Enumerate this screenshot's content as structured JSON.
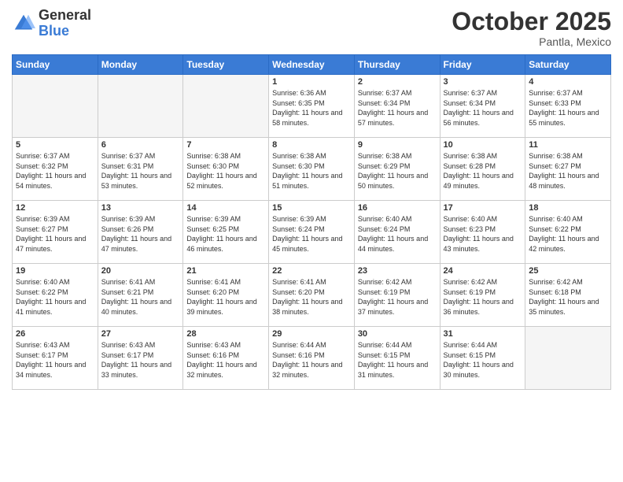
{
  "logo": {
    "general": "General",
    "blue": "Blue"
  },
  "header": {
    "month": "October 2025",
    "location": "Pantla, Mexico"
  },
  "weekdays": [
    "Sunday",
    "Monday",
    "Tuesday",
    "Wednesday",
    "Thursday",
    "Friday",
    "Saturday"
  ],
  "weeks": [
    [
      {
        "day": "",
        "empty": true
      },
      {
        "day": "",
        "empty": true
      },
      {
        "day": "",
        "empty": true
      },
      {
        "day": "1",
        "sunrise": "6:36 AM",
        "sunset": "6:35 PM",
        "daylight": "11 hours and 58 minutes."
      },
      {
        "day": "2",
        "sunrise": "6:37 AM",
        "sunset": "6:34 PM",
        "daylight": "11 hours and 57 minutes."
      },
      {
        "day": "3",
        "sunrise": "6:37 AM",
        "sunset": "6:34 PM",
        "daylight": "11 hours and 56 minutes."
      },
      {
        "day": "4",
        "sunrise": "6:37 AM",
        "sunset": "6:33 PM",
        "daylight": "11 hours and 55 minutes."
      }
    ],
    [
      {
        "day": "5",
        "sunrise": "6:37 AM",
        "sunset": "6:32 PM",
        "daylight": "11 hours and 54 minutes."
      },
      {
        "day": "6",
        "sunrise": "6:37 AM",
        "sunset": "6:31 PM",
        "daylight": "11 hours and 53 minutes."
      },
      {
        "day": "7",
        "sunrise": "6:38 AM",
        "sunset": "6:30 PM",
        "daylight": "11 hours and 52 minutes."
      },
      {
        "day": "8",
        "sunrise": "6:38 AM",
        "sunset": "6:30 PM",
        "daylight": "11 hours and 51 minutes."
      },
      {
        "day": "9",
        "sunrise": "6:38 AM",
        "sunset": "6:29 PM",
        "daylight": "11 hours and 50 minutes."
      },
      {
        "day": "10",
        "sunrise": "6:38 AM",
        "sunset": "6:28 PM",
        "daylight": "11 hours and 49 minutes."
      },
      {
        "day": "11",
        "sunrise": "6:38 AM",
        "sunset": "6:27 PM",
        "daylight": "11 hours and 48 minutes."
      }
    ],
    [
      {
        "day": "12",
        "sunrise": "6:39 AM",
        "sunset": "6:27 PM",
        "daylight": "11 hours and 47 minutes."
      },
      {
        "day": "13",
        "sunrise": "6:39 AM",
        "sunset": "6:26 PM",
        "daylight": "11 hours and 47 minutes."
      },
      {
        "day": "14",
        "sunrise": "6:39 AM",
        "sunset": "6:25 PM",
        "daylight": "11 hours and 46 minutes."
      },
      {
        "day": "15",
        "sunrise": "6:39 AM",
        "sunset": "6:24 PM",
        "daylight": "11 hours and 45 minutes."
      },
      {
        "day": "16",
        "sunrise": "6:40 AM",
        "sunset": "6:24 PM",
        "daylight": "11 hours and 44 minutes."
      },
      {
        "day": "17",
        "sunrise": "6:40 AM",
        "sunset": "6:23 PM",
        "daylight": "11 hours and 43 minutes."
      },
      {
        "day": "18",
        "sunrise": "6:40 AM",
        "sunset": "6:22 PM",
        "daylight": "11 hours and 42 minutes."
      }
    ],
    [
      {
        "day": "19",
        "sunrise": "6:40 AM",
        "sunset": "6:22 PM",
        "daylight": "11 hours and 41 minutes."
      },
      {
        "day": "20",
        "sunrise": "6:41 AM",
        "sunset": "6:21 PM",
        "daylight": "11 hours and 40 minutes."
      },
      {
        "day": "21",
        "sunrise": "6:41 AM",
        "sunset": "6:20 PM",
        "daylight": "11 hours and 39 minutes."
      },
      {
        "day": "22",
        "sunrise": "6:41 AM",
        "sunset": "6:20 PM",
        "daylight": "11 hours and 38 minutes."
      },
      {
        "day": "23",
        "sunrise": "6:42 AM",
        "sunset": "6:19 PM",
        "daylight": "11 hours and 37 minutes."
      },
      {
        "day": "24",
        "sunrise": "6:42 AM",
        "sunset": "6:19 PM",
        "daylight": "11 hours and 36 minutes."
      },
      {
        "day": "25",
        "sunrise": "6:42 AM",
        "sunset": "6:18 PM",
        "daylight": "11 hours and 35 minutes."
      }
    ],
    [
      {
        "day": "26",
        "sunrise": "6:43 AM",
        "sunset": "6:17 PM",
        "daylight": "11 hours and 34 minutes."
      },
      {
        "day": "27",
        "sunrise": "6:43 AM",
        "sunset": "6:17 PM",
        "daylight": "11 hours and 33 minutes."
      },
      {
        "day": "28",
        "sunrise": "6:43 AM",
        "sunset": "6:16 PM",
        "daylight": "11 hours and 32 minutes."
      },
      {
        "day": "29",
        "sunrise": "6:44 AM",
        "sunset": "6:16 PM",
        "daylight": "11 hours and 32 minutes."
      },
      {
        "day": "30",
        "sunrise": "6:44 AM",
        "sunset": "6:15 PM",
        "daylight": "11 hours and 31 minutes."
      },
      {
        "day": "31",
        "sunrise": "6:44 AM",
        "sunset": "6:15 PM",
        "daylight": "11 hours and 30 minutes."
      },
      {
        "day": "",
        "empty": true
      }
    ]
  ]
}
